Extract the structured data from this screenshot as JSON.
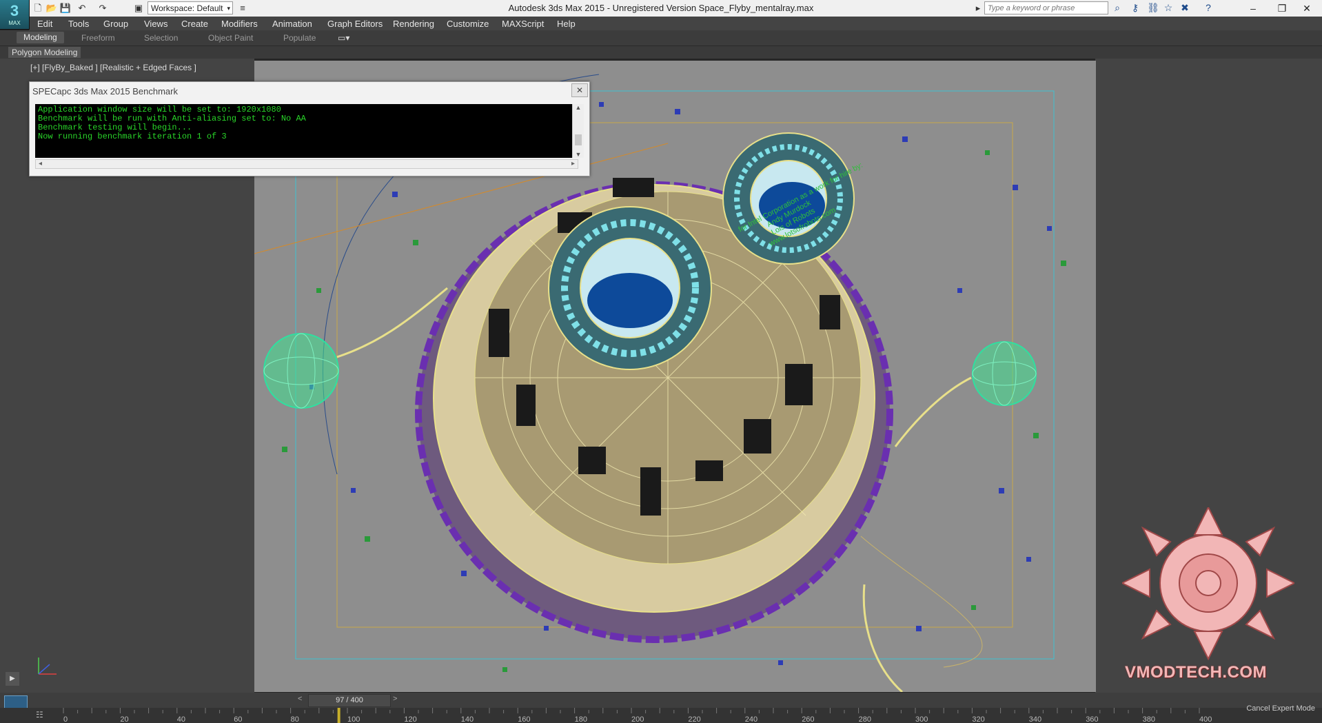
{
  "app": {
    "logo_text": "MAX",
    "window_title": "Autodesk 3ds Max  2015   - Unregistered Version     Space_Flyby_mentalray.max",
    "workspace_label": "Workspace: Default",
    "search_placeholder": "Type a keyword or phrase"
  },
  "menu": [
    "Edit",
    "Tools",
    "Group",
    "Views",
    "Create",
    "Modifiers",
    "Animation",
    "Graph Editors",
    "Rendering",
    "Customize",
    "MAXScript",
    "Help"
  ],
  "ribbon": {
    "tabs": [
      "Modeling",
      "Freeform",
      "Selection",
      "Object Paint",
      "Populate"
    ],
    "active_tab": "Modeling",
    "panel_label": "Polygon Modeling"
  },
  "viewport": {
    "label": "[+] [FlyBy_Baked ] [Realistic + Edged Faces ]",
    "annotation_lines": [
      "for Intel Corporation as a work for hire by:",
      "Andy Murdock",
      "Lois of Robots",
      "www.lotsofrobots.com"
    ]
  },
  "dialog": {
    "title": "SPECapc 3ds Max 2015 Benchmark",
    "close_label": "✕",
    "console_lines": [
      "Application window size will be set to:  1920x1080",
      "Benchmark will be run with Anti-aliasing set to: No AA",
      "Benchmark testing will begin...",
      "Now running benchmark iteration 1 of 3"
    ]
  },
  "timeline": {
    "frame_counter": "97 / 400",
    "current_frame": 97,
    "total_frames": 400,
    "ruler_ticks": [
      "0",
      "20",
      "40",
      "60",
      "80",
      "100",
      "120",
      "140",
      "160",
      "180",
      "200",
      "220",
      "240",
      "260",
      "280",
      "300",
      "320",
      "340",
      "360",
      "380",
      "400"
    ]
  },
  "status": {
    "cancel_expert_mode": "Cancel Expert Mode"
  },
  "watermark": {
    "text": "VMODTECH.COM"
  },
  "colors": {
    "console_text": "#29d629",
    "viewport_bg": "#8e8e8e",
    "ship_wire": "#e8e08a",
    "orb_green": "#3fe08f",
    "accent_purple": "#7a2fb5"
  },
  "icons": [
    "new-file-icon",
    "open-file-icon",
    "save-icon",
    "undo-icon",
    "redo-icon",
    "project-icon",
    "search-binoculars-icon",
    "key-icon",
    "star-icon",
    "close-x-icon",
    "help-icon"
  ]
}
